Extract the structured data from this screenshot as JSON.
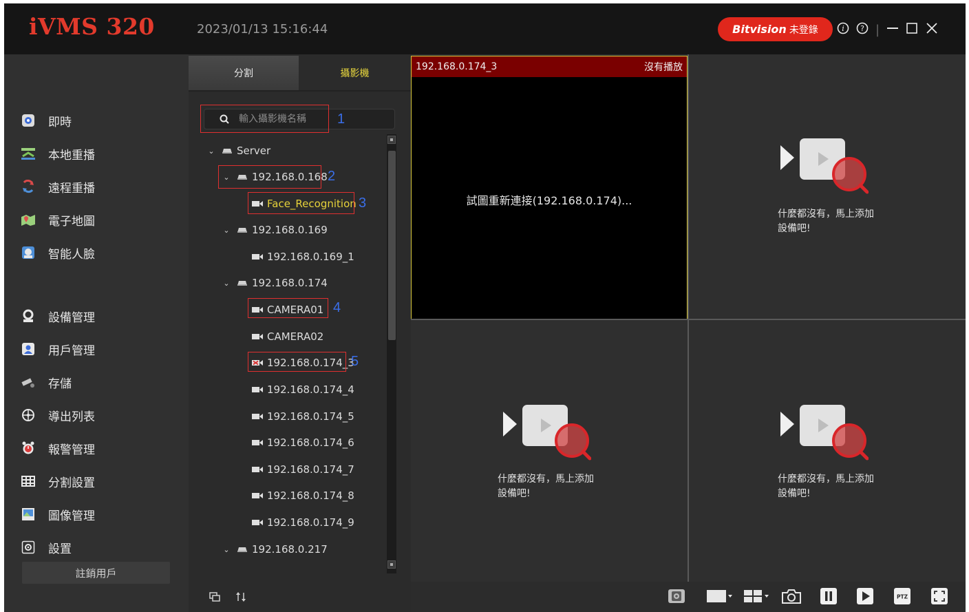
{
  "app": {
    "brand": "iVMS 320",
    "datetime": "2023/01/13 15:16:44",
    "bitvision_logo": "Bitvision",
    "bitvision_status": "未登錄",
    "window_controls": [
      "info-icon",
      "help-icon",
      "minimize-icon",
      "maximize-icon",
      "close-icon"
    ]
  },
  "sidebar": {
    "items": [
      {
        "label": "即時",
        "icon": "live-view-icon"
      },
      {
        "label": "本地重播",
        "icon": "local-playback-icon"
      },
      {
        "label": "遠程重播",
        "icon": "remote-playback-icon"
      },
      {
        "label": "電子地圖",
        "icon": "e-map-icon"
      },
      {
        "label": "智能人臉",
        "icon": "face-recognition-icon"
      },
      {
        "label": "設備管理",
        "icon": "device-management-icon"
      },
      {
        "label": "用戶管理",
        "icon": "user-management-icon"
      },
      {
        "label": "存儲",
        "icon": "storage-icon"
      },
      {
        "label": "導出列表",
        "icon": "export-list-icon"
      },
      {
        "label": "報警管理",
        "icon": "alarm-clock-icon"
      },
      {
        "label": "分割設置",
        "icon": "split-settings-icon"
      },
      {
        "label": "圖像管理",
        "icon": "image-management-icon"
      },
      {
        "label": "設置",
        "icon": "settings-icon"
      }
    ],
    "logout_label": "註銷用戶"
  },
  "panel": {
    "tabs": {
      "split": "分割",
      "camera": "攝影機"
    },
    "search_placeholder": "輸入攝影機名稱",
    "tree": {
      "server": "Server",
      "devices": [
        {
          "name": "192.168.0.168",
          "channels": [
            "Face_Recognition"
          ]
        },
        {
          "name": "192.168.0.169",
          "channels": [
            "192.168.0.169_1"
          ]
        },
        {
          "name": "192.168.0.174",
          "channels": [
            "CAMERA01",
            "CAMERA02",
            "192.168.0.174_3",
            "192.168.0.174_4",
            "192.168.0.174_5",
            "192.168.0.174_6",
            "192.168.0.174_7",
            "192.168.0.174_8",
            "192.168.0.174_9"
          ]
        },
        {
          "name": "192.168.0.217",
          "channels": []
        }
      ]
    },
    "annotations": [
      "1",
      "2",
      "3",
      "4",
      "5"
    ],
    "footer_icons": [
      "copy-icon",
      "sort-icon"
    ]
  },
  "grid": {
    "active_cell": {
      "title": "192.168.0.174_3",
      "status": "沒有播放",
      "message": "試圖重新連接(192.168.0.174)..."
    },
    "empty_text_line1": "什麼都沒有，馬上添加",
    "empty_text_line2": "設備吧!"
  },
  "toolbar": {
    "icons": [
      "stream-icon",
      "window-layout-icon",
      "split-layout-icon",
      "snapshot-icon",
      "pause-all-icon",
      "play-icon",
      "ptz-icon",
      "fullscreen-icon"
    ],
    "ptz_label": "PTZ"
  },
  "colors": {
    "brand_red": "#e23a2c",
    "bitvision_button": "#e0271c",
    "active_tab_text": "#e6d23a",
    "active_cell_border": "#d9c93c",
    "cell_header": "#7a0000",
    "annotation_box": "#e03030",
    "annotation_number": "#3a6ee8"
  }
}
